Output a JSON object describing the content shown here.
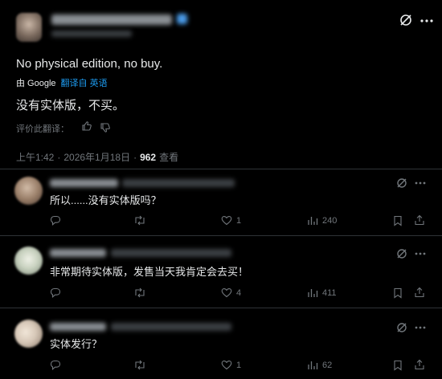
{
  "main_post": {
    "original_text": "No physical edition, no buy.",
    "translate_by": "由 Google",
    "translate_link": "翻译自 英语",
    "translated_text": "没有实体版，不买。",
    "rate_translation": "评价此翻译：",
    "time": "上午1:42",
    "date": "2026年1月18日",
    "views_count": "962",
    "views_label": "查看"
  },
  "replies": [
    {
      "text": "所以......没有实体版吗？",
      "likes": "1",
      "views": "240",
      "avatar_color": "#b59a85"
    },
    {
      "text": "非常期待实体版，发售当天我肯定会去买！",
      "likes": "4",
      "views": "411",
      "avatar_color": "#c9d2c0"
    },
    {
      "text": "实体发行？",
      "likes": "1",
      "views": "62",
      "avatar_color": "#d6c7b7"
    }
  ],
  "colors": {
    "background": "#000000",
    "text": "#e7e9ea",
    "muted": "#71767b",
    "accent": "#1d9bf0",
    "divider": "#2f3336"
  },
  "icons": {
    "grok": "grok-icon",
    "more": "more-icon",
    "reply": "reply-icon",
    "repost": "repost-icon",
    "like": "heart-icon",
    "views": "views-icon",
    "bookmark": "bookmark-icon",
    "share": "share-icon",
    "thumbs_up": "thumbs-up-icon",
    "thumbs_down": "thumbs-down-icon"
  }
}
